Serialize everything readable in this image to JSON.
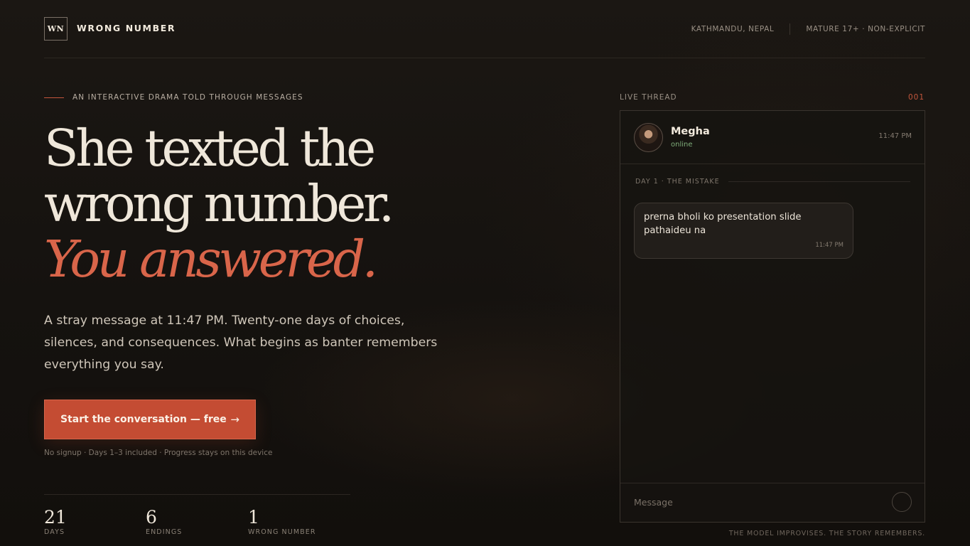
{
  "header": {
    "logo_mark": "WN",
    "brand": "WRONG NUMBER",
    "location": "KATHMANDU, NEPAL",
    "rating": "MATURE 17+ · NON-EXPLICIT"
  },
  "hero": {
    "eyebrow": "AN INTERACTIVE DRAMA TOLD THROUGH MESSAGES",
    "headline_line1": "She texted the",
    "headline_line2": "wrong number.",
    "headline_accent": "You answered.",
    "lede": "A stray message at 11:47 PM. Twenty-one days of choices, silences, and consequences. What begins as banter remembers everything you say.",
    "cta_label": "Start the conversation — free",
    "cta_arrow": "→",
    "fine_print": "No signup · Days 1–3 included · Progress stays on this device"
  },
  "stats": [
    {
      "value": "21",
      "label": "DAYS"
    },
    {
      "value": "6",
      "label": "ENDINGS"
    },
    {
      "value": "1",
      "label": "WRONG NUMBER"
    }
  ],
  "thread": {
    "label": "LIVE THREAD",
    "index": "001",
    "contact_name": "Megha",
    "contact_status": "online",
    "contact_time": "11:47 PM",
    "day_label": "DAY 1 · THE MISTAKE",
    "message_text": "prerna bholi ko presentation slide pathaideu na",
    "message_time": "11:47 PM",
    "composer_placeholder": "Message"
  },
  "footer_note": "THE MODEL IMPROVISES. THE STORY REMEMBERS.",
  "colors": {
    "accent": "#c44c33",
    "headline_accent": "#d9654a",
    "online": "#7fae7a",
    "background": "#16130f"
  },
  "icons": {
    "cta_arrow": "arrow-right-icon",
    "send": "send-icon"
  }
}
